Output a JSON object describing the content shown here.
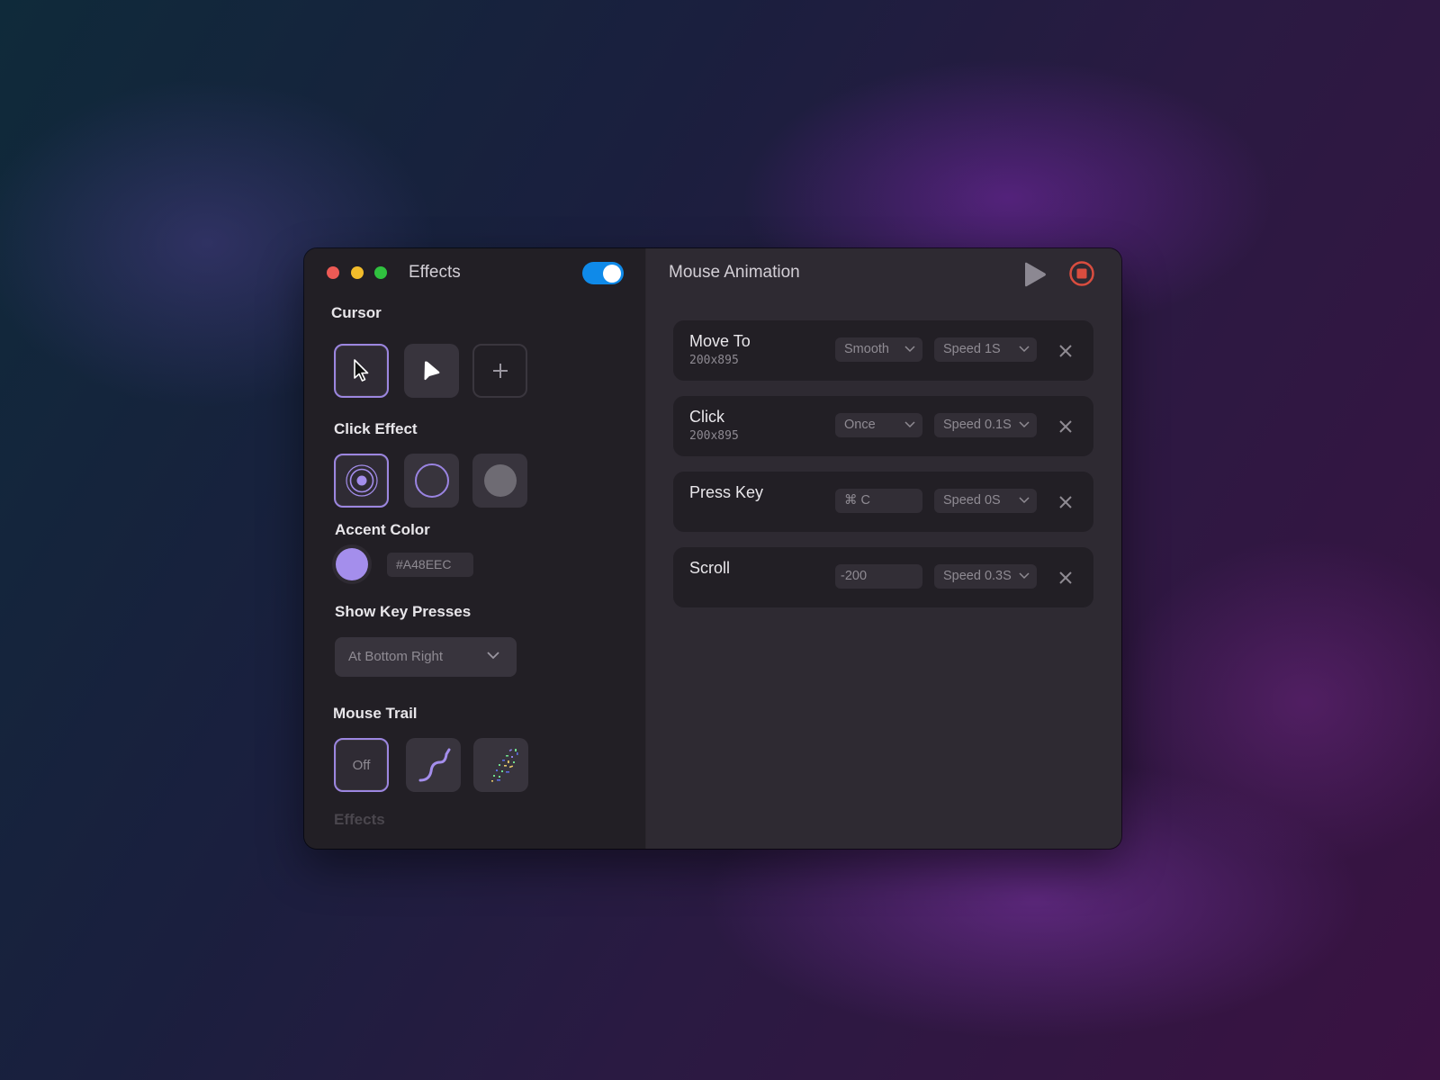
{
  "window": {
    "title": "Effects",
    "effects_enabled": true
  },
  "left": {
    "cursor": {
      "label": "Cursor",
      "options": [
        {
          "icon": "arrow-cursor-icon",
          "selected": true
        },
        {
          "icon": "pointer-triangle-icon",
          "selected": false
        },
        {
          "icon": "plus-icon",
          "selected": false
        }
      ]
    },
    "click_effect": {
      "label": "Click Effect",
      "options": [
        {
          "icon": "ripple-dot-icon",
          "selected": true
        },
        {
          "icon": "ring-icon",
          "selected": false
        },
        {
          "icon": "filled-circle-icon",
          "selected": false
        }
      ]
    },
    "accent": {
      "label": "Accent Color",
      "value": "#A48EEC",
      "color": "#a48eec"
    },
    "key_presses": {
      "label": "Show Key Presses",
      "selected": "At Bottom Right"
    },
    "mouse_trail": {
      "label": "Mouse Trail",
      "off_label": "Off",
      "options": [
        {
          "icon": "off",
          "selected": true
        },
        {
          "icon": "wave-trail-icon",
          "selected": false
        },
        {
          "icon": "confetti-trail-icon",
          "selected": false
        }
      ]
    },
    "next_section_label": "Effects"
  },
  "right": {
    "title": "Mouse Animation",
    "actions": [
      {
        "name": "Move To",
        "coord": "200x895",
        "param": "Smooth",
        "param_type": "select",
        "speed": "Speed 1S"
      },
      {
        "name": "Click",
        "coord": "200x895",
        "param": "Once",
        "param_type": "select",
        "speed": "Speed 0.1S"
      },
      {
        "name": "Press Key",
        "coord": "",
        "param": "⌘ C",
        "param_type": "input",
        "speed": "Speed 0S"
      },
      {
        "name": "Scroll",
        "coord": "",
        "param": "-200",
        "param_type": "input",
        "speed": "Speed 0.3S"
      }
    ]
  },
  "colors": {
    "accent": "#a48eec",
    "toggle_on": "#0f8ae9",
    "stop": "#d94d3f"
  }
}
